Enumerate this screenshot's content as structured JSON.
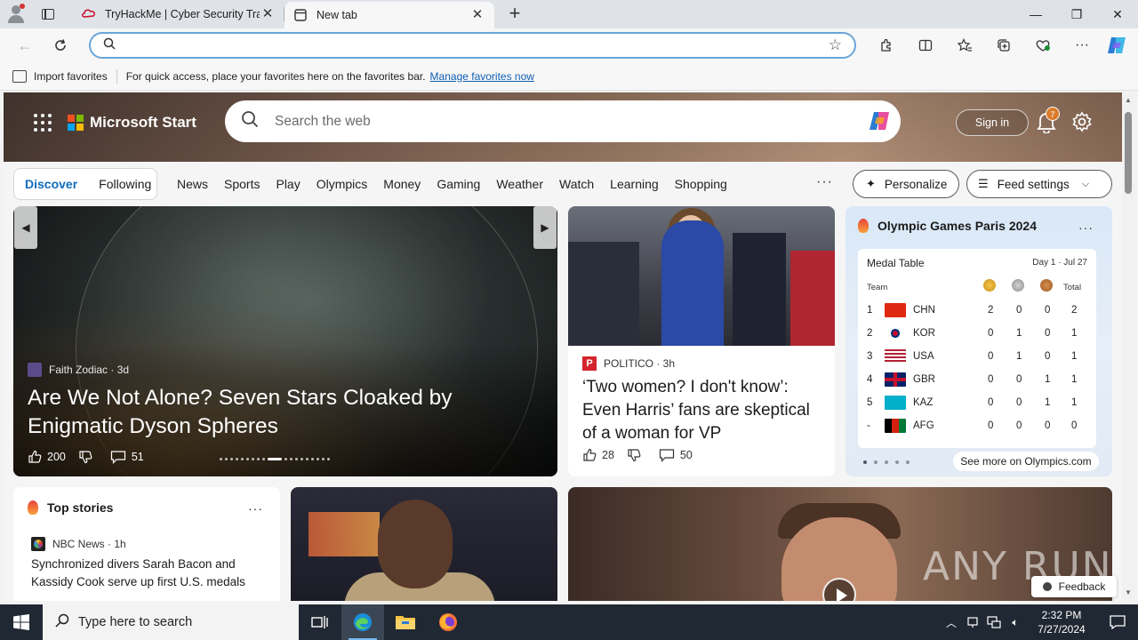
{
  "browser": {
    "tabs": [
      {
        "title": "TryHackMe | Cyber Security Training"
      },
      {
        "title": "New tab"
      }
    ],
    "address": {
      "value": "",
      "placeholder": ""
    },
    "favorites_bar": {
      "import_label": "Import favorites",
      "message": "For quick access, place your favorites here on the favorites bar.",
      "manage_link": "Manage favorites now"
    }
  },
  "msn": {
    "brand": "Microsoft Start",
    "search_placeholder": "Search the web",
    "sign_in": "Sign in",
    "notification_count": "7",
    "feed_toggle": {
      "discover": "Discover",
      "following": "Following"
    },
    "nav": [
      "News",
      "Sports",
      "Play",
      "Olympics",
      "Money",
      "Gaming",
      "Weather",
      "Watch",
      "Learning",
      "Shopping"
    ],
    "more": "···",
    "personalize": "Personalize",
    "feed_settings": "Feed settings",
    "hero": {
      "source": "Faith Zodiac · 3d",
      "title": "Are We Not Alone? Seven Stars Cloaked by Enigmatic Dyson Spheres",
      "likes": "200",
      "comments": "51",
      "carousel": {
        "count": 19,
        "active": 9
      }
    },
    "politico": {
      "source": "POLITICO · 3h",
      "logo_letter": "P",
      "headline": "‘Two women? I don't know’: Even Harris’ fans are skeptical of a woman for VP",
      "likes": "28",
      "comments": "50"
    },
    "olympics": {
      "title": "Olympic Games Paris 2024",
      "table_title": "Medal Table",
      "date": "Day 1 · Jul 27",
      "col_team": "Team",
      "col_total": "Total",
      "rows": [
        {
          "rank": "1",
          "team": "CHN",
          "gold": "2",
          "silver": "0",
          "bronze": "0",
          "total": "2"
        },
        {
          "rank": "2",
          "team": "KOR",
          "gold": "0",
          "silver": "1",
          "bronze": "0",
          "total": "1"
        },
        {
          "rank": "3",
          "team": "USA",
          "gold": "0",
          "silver": "1",
          "bronze": "0",
          "total": "1"
        },
        {
          "rank": "4",
          "team": "GBR",
          "gold": "0",
          "silver": "0",
          "bronze": "1",
          "total": "1"
        },
        {
          "rank": "5",
          "team": "KAZ",
          "gold": "0",
          "silver": "0",
          "bronze": "1",
          "total": "1"
        },
        {
          "rank": "-",
          "team": "AFG",
          "gold": "0",
          "silver": "0",
          "bronze": "0",
          "total": "0"
        }
      ],
      "see_more": "See more on Olympics.com"
    },
    "top_stories": {
      "title": "Top stories",
      "source": "NBC News · 1h",
      "headline": "Synchronized divers Sarah Bacon and Kassidy Cook serve up first U.S. medals"
    },
    "watermark": "ANY RUN",
    "feedback": "Feedback"
  },
  "taskbar": {
    "search_placeholder": "Type here to search",
    "time": "2:32 PM",
    "date": "7/27/2024"
  },
  "colors": {
    "accent": "#0f6cbd",
    "taskbar": "#202833",
    "politico_red": "#d4242d"
  }
}
